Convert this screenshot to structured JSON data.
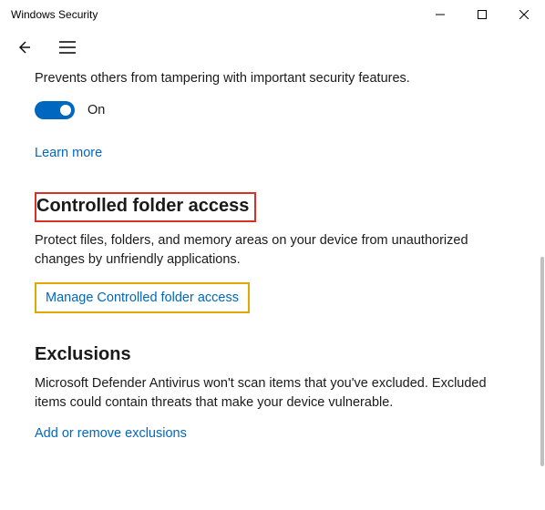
{
  "window": {
    "title": "Windows Security"
  },
  "tamper": {
    "desc": "Prevents others from tampering with important security features.",
    "toggle_state": "On",
    "learn_more": "Learn more"
  },
  "cfa": {
    "heading": "Controlled folder access",
    "desc": "Protect files, folders, and memory areas on your device from unauthorized changes by unfriendly applications.",
    "manage_link": "Manage Controlled folder access"
  },
  "exclusions": {
    "heading": "Exclusions",
    "desc": "Microsoft Defender Antivirus won't scan items that you've excluded. Excluded items could contain threats that make your device vulnerable.",
    "link": "Add or remove exclusions"
  }
}
